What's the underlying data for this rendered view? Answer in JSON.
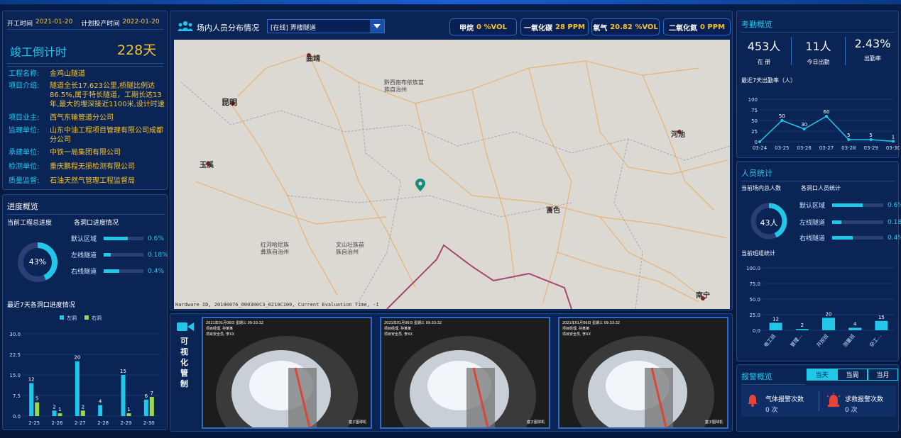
{
  "project": {
    "start_label": "开工时间",
    "start_date": "2021-01-20",
    "plan_label": "计划投产时间",
    "plan_date": "2022-01-20",
    "countdown_label": "竣工倒计时",
    "countdown_value": "228天",
    "fields": [
      {
        "key": "工程名称:",
        "value": "金鸡山隧道"
      },
      {
        "key": "项目介绍:",
        "value": "隧道全长17.623公里,桥隧比例达86.5%,属于特长隧道，工期长达13年,最大的埋深接近1100米,设计时速"
      },
      {
        "key": "项目业主:",
        "value": "西气东输管道分公司"
      },
      {
        "key": "监理单位:",
        "value": "山东中油工程项目管理有限公司成都分公司"
      },
      {
        "key": "承建单位:",
        "value": "中铁一局集团有限公司"
      },
      {
        "key": "检测单位:",
        "value": "重庆鹏程无损检测有限公司"
      },
      {
        "key": "质量监督:",
        "value": "石油天然气管理工程监督局"
      }
    ]
  },
  "progress": {
    "title": "进度概览",
    "total_label": "当前工程总进度",
    "total_value": "43%",
    "total_fraction": 0.43,
    "holes_label": "各洞口进度情况",
    "holes": [
      {
        "name": "默认区域",
        "value": "0.6%",
        "fraction": 0.6
      },
      {
        "name": "左线隧道",
        "value": "0.18%",
        "fraction": 0.18
      },
      {
        "name": "右线隧道",
        "value": "0.4%",
        "fraction": 0.4
      }
    ],
    "chart_title": "最近7天各洞口进度情况"
  },
  "map_panel": {
    "title": "场内人员分布情况",
    "select_value": "[在线] 弄楼隧道",
    "gases": [
      {
        "name": "甲烷",
        "value": "0 %VOL"
      },
      {
        "name": "一氧化碳",
        "value": "28 PPM"
      },
      {
        "name": "氧气",
        "value": "20.82 %VOL"
      },
      {
        "name": "二氧化氮",
        "value": "0 PPM"
      }
    ],
    "map_labels": {
      "kunming": "昆明",
      "qujing": "曲靖",
      "baise": "百色",
      "nanning": "南宁",
      "hechi": "河池",
      "yuxi": "玉溪",
      "guizhou": "黔西南布依族苗族自治州",
      "wenshan": "文山壮族苗族自治州",
      "honghe": "红河哈尼族彝族自治州"
    },
    "footer_text": "Hardware ID, 20100076_000300C3_0210C100, Current Evaluation Time, -1"
  },
  "video": {
    "label": "可视化管制",
    "cams": [
      {
        "overlay1": "2021年01月06日 星期三 09:33:32",
        "overlay2": "项目经理, 孙某某",
        "overlay3": "项目安全员, 李XX",
        "corner": "塞子图球机"
      },
      {
        "overlay1": "2021年01月06日 星期三 09:33:32",
        "overlay2": "项目经理, 孙某某",
        "overlay3": "项目安全员, 李XX",
        "corner": "塞子图球机"
      },
      {
        "overlay1": "2021年01月06日 星期三 09:33:32",
        "overlay2": "项目经理, 孙某某",
        "overlay3": "项目安全员, 李XX",
        "corner": "塞子图球机"
      }
    ]
  },
  "attendance": {
    "title": "考勤概览",
    "stats": [
      {
        "value": "453人",
        "label": "在 册"
      },
      {
        "value": "11人",
        "label": "今日出勤"
      },
      {
        "value": "2.43%",
        "label": "出勤率"
      }
    ],
    "chart_title": "最近7天出勤率（人）"
  },
  "personnel": {
    "title": "人员统计",
    "total_label": "当前场内总人数",
    "total_value": "43人",
    "total_fraction": 0.43,
    "holes_label": "各洞口人员统计",
    "holes": [
      {
        "name": "默认区域",
        "value": "0.6%",
        "fraction": 0.6
      },
      {
        "name": "左线隧道",
        "value": "0.18%",
        "fraction": 0.18
      },
      {
        "name": "右线隧道",
        "value": "0.4%",
        "fraction": 0.4
      }
    ],
    "team_label": "当前班组统计"
  },
  "alarm": {
    "title": "报警概览",
    "tabs": [
      "当天",
      "当周",
      "当月"
    ],
    "gas_label": "气体报警次数",
    "gas_value": "0 次",
    "help_label": "求救报警次数",
    "help_value": "0 次"
  },
  "colors": {
    "cyan": "#21c7e8",
    "green": "#9ad94a",
    "yellow": "#f4c330"
  },
  "chart_data": [
    {
      "type": "bar",
      "title": "最近7天各洞口进度情况",
      "categories": [
        "2-25",
        "2-26",
        "2-27",
        "2-28",
        "2-29",
        "2-30"
      ],
      "series": [
        {
          "name": "左洞",
          "values": [
            12,
            2,
            20,
            4,
            15,
            6
          ]
        },
        {
          "name": "右洞",
          "values": [
            5,
            1,
            2,
            null,
            1,
            7
          ]
        }
      ],
      "ylim": [
        0,
        30
      ],
      "yticks": [
        "0.0",
        "7.5",
        "15.0",
        "22.5",
        "30.0"
      ],
      "legend": "top"
    },
    {
      "type": "line",
      "title": "最近7天出勤率（人）",
      "categories": [
        "03-24",
        "03-25",
        "03-26",
        "03-27",
        "03-28",
        "03-29",
        "03-30"
      ],
      "values": [
        0,
        50,
        30,
        60,
        5,
        5,
        1
      ],
      "labels": [
        "",
        "50",
        "30",
        "60",
        "5",
        "5",
        "1"
      ],
      "ylim": [
        0,
        100
      ],
      "yticks": [
        "0",
        "25",
        "50",
        "75",
        "100"
      ]
    },
    {
      "type": "bar",
      "title": "当前班组统计",
      "categories": [
        "电工班",
        "管理...",
        "开挖班",
        "测量班",
        "杂工..."
      ],
      "values": [
        12,
        2,
        20,
        4,
        15
      ],
      "ylim": [
        0,
        100
      ],
      "yticks": [
        "0.0",
        "25.0",
        "50.0",
        "75.0",
        "100.0"
      ]
    }
  ]
}
